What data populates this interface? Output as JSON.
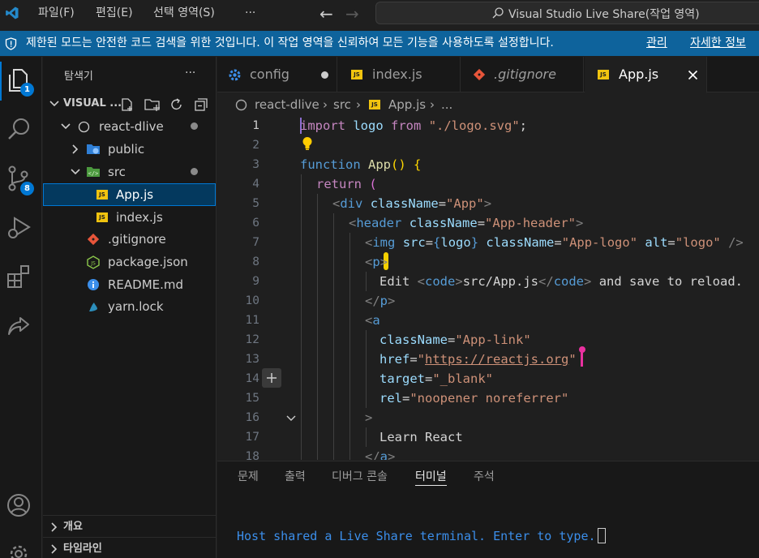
{
  "titlebar": {
    "menus": [
      "파일(F)",
      "편집(E)",
      "선택 영역(S)",
      "···"
    ],
    "search_text": "Visual Studio Live Share(작업 영역)"
  },
  "banner": {
    "message": "제한된 모드는 안전한 코드 검색을 위한 것입니다. 이 작업 영역을 신뢰하여 모든 기능을 사용하도록 설정합니다.",
    "manage": "관리",
    "learn_more": "자세한 정보"
  },
  "activitybar": {
    "explorer_badge": "1",
    "scm_badge": "8"
  },
  "sidebar": {
    "title": "탐색기",
    "more": "···",
    "workspace": "VISUAL ...",
    "tree": [
      {
        "label": "react-dlive"
      },
      {
        "label": "public"
      },
      {
        "label": "src"
      },
      {
        "label": "App.js"
      },
      {
        "label": "index.js"
      },
      {
        "label": ".gitignore"
      },
      {
        "label": "package.json"
      },
      {
        "label": "README.md"
      },
      {
        "label": "yarn.lock"
      }
    ],
    "sections": [
      "개요",
      "타임라인"
    ]
  },
  "tabs": [
    {
      "label": "config"
    },
    {
      "label": "index.js"
    },
    {
      "label": ".gitignore"
    },
    {
      "label": "App.js"
    }
  ],
  "breadcrumb": [
    "react-dlive",
    "src",
    "App.js",
    "..."
  ],
  "editor": {
    "line_numbers": [
      "1",
      "2",
      "3",
      "4",
      "5",
      "6",
      "7",
      "8",
      "9",
      "10",
      "11",
      "12",
      "13",
      "14",
      "15",
      "16",
      "17",
      "18"
    ],
    "code": {
      "l1": [
        "import",
        "logo",
        "from",
        "\"./logo.svg\"",
        ";"
      ],
      "l3": [
        "function",
        "App",
        "()",
        "{"
      ],
      "l4": [
        "return",
        "("
      ],
      "l5": [
        "<",
        "div",
        "className",
        "=",
        "\"App\"",
        ">"
      ],
      "l6": [
        "<",
        "header",
        "className",
        "=",
        "\"App-header\"",
        ">"
      ],
      "l7": [
        "<",
        "img",
        "src",
        "=",
        "{",
        "logo",
        "}",
        "className",
        "=",
        "\"App-logo\"",
        "alt",
        "=",
        "\"logo\"",
        "/>"
      ],
      "l8": [
        "<",
        "p",
        ">"
      ],
      "l9": [
        "Edit ",
        "<",
        "code",
        ">",
        "src/App.js",
        "</",
        "code",
        ">",
        " and save to reload."
      ],
      "l10": [
        "</",
        "p",
        ">"
      ],
      "l11": [
        "<",
        "a"
      ],
      "l12": [
        "className",
        "=",
        "\"App-link\""
      ],
      "l13": [
        "href",
        "=",
        "\"",
        "https://reactjs.org",
        "\""
      ],
      "l14": [
        "target",
        "=",
        "\"_blank\""
      ],
      "l15": [
        "rel",
        "=",
        "\"noopener noreferrer\""
      ],
      "l16": [
        ">"
      ],
      "l17": [
        "Learn React"
      ],
      "l18": [
        "</",
        "a",
        ">"
      ]
    }
  },
  "panel": {
    "tabs": [
      "문제",
      "출력",
      "디버그 콘솔",
      "터미널",
      "주석"
    ],
    "terminal_text": "Host shared a Live Share terminal. Enter to type."
  },
  "colors": {
    "accent": "#0078d4",
    "banner_bg": "#0e639c",
    "js_icon": "#f1c40f",
    "git_icon": "#e8553a"
  }
}
